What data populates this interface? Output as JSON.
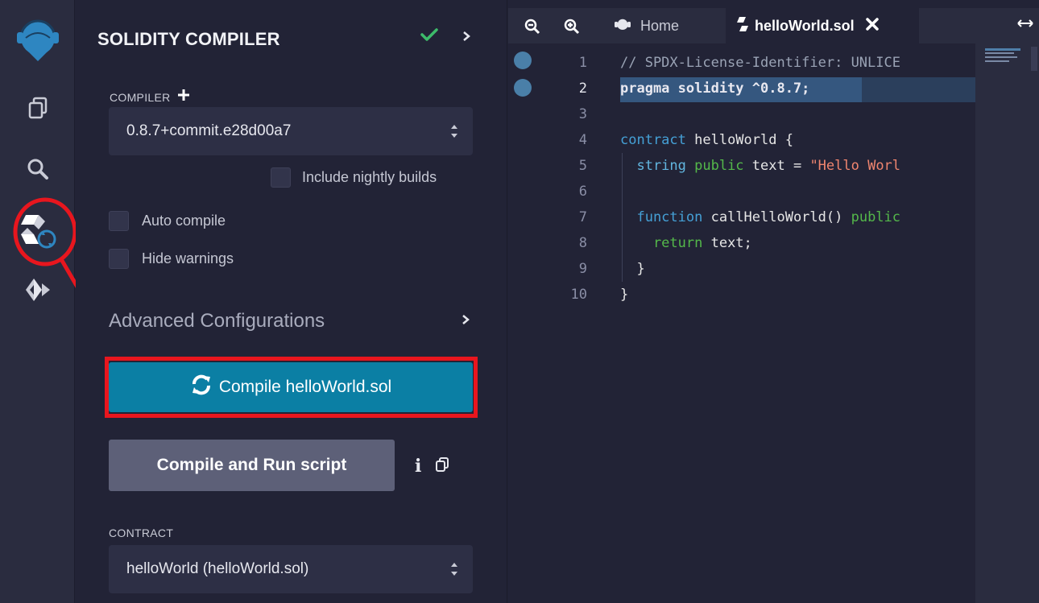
{
  "colors": {
    "accent": "#0b7fa4",
    "highlight": "#e8161e",
    "rail_bg": "#2a2c3f",
    "panel_bg": "#222336"
  },
  "rail": {
    "icons": [
      "remix-logo-icon",
      "file-explorer-icon",
      "search-icon",
      "solidity-compiler-icon",
      "deploy-run-icon"
    ]
  },
  "panel": {
    "title": "SOLIDITY COMPILER",
    "compiler_label": "COMPILER",
    "compiler_version": "0.8.7+commit.e28d00a7",
    "include_nightly": "Include nightly builds",
    "auto_compile": "Auto compile",
    "hide_warnings": "Hide warnings",
    "advanced": "Advanced Configurations",
    "compile_button": "Compile helloWorld.sol",
    "compile_run_button": "Compile and Run script",
    "contract_label": "CONTRACT",
    "contract_value": "helloWorld (helloWorld.sol)"
  },
  "editor": {
    "tabs": {
      "home": "Home",
      "file": "helloWorld.sol"
    },
    "line_numbers": [
      "1",
      "2",
      "3",
      "4",
      "5",
      "6",
      "7",
      "8",
      "9",
      "10"
    ],
    "code": {
      "l1": "// SPDX-License-Identifier: UNLICE",
      "l2": "pragma solidity ^0.8.7;",
      "l4a": "contract ",
      "l4b": "helloWorld {",
      "l5a": "  string ",
      "l5b": "public ",
      "l5c": "text = ",
      "l5d": "\"Hello Worl",
      "l7a": "  function ",
      "l7b": "callHelloWorld() ",
      "l7c": "public",
      "l8a": "    return ",
      "l8b": "text;",
      "l9": "  }",
      "l10": "}"
    }
  }
}
